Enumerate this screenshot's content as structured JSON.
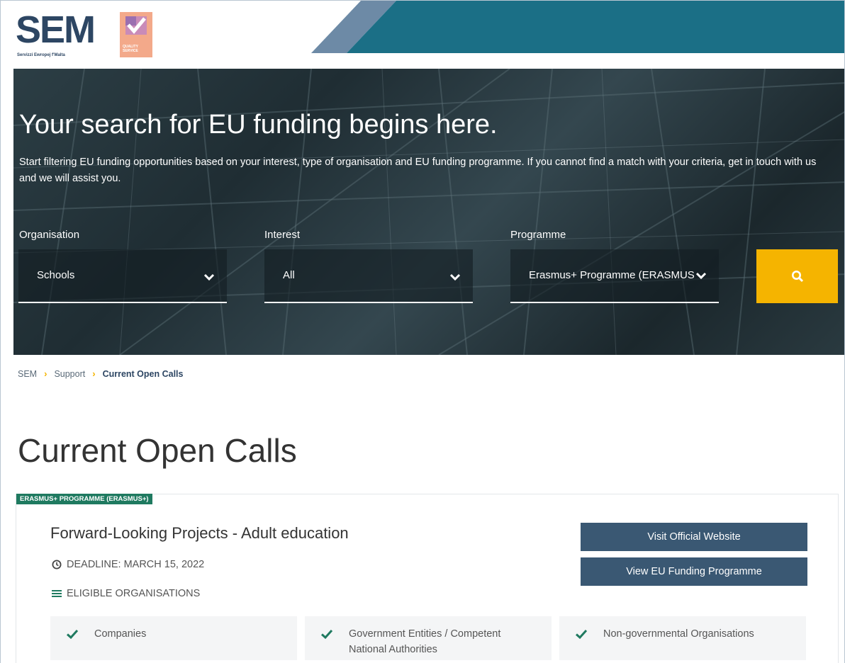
{
  "header": {
    "logo_text": "SEM",
    "logo_tagline": "Servizzi Ewropej f'Malta",
    "quality_badge_text": "QUALITY SERVICE",
    "colors": {
      "logo_navy": "#2d4663",
      "banner_teal": "#1b6f86",
      "banner_light": "#6d8aa6",
      "quality_orange": "#f3a98a"
    }
  },
  "hero": {
    "title": "Your search for EU funding begins here.",
    "text": "Start filtering EU funding opportunities based on your interest, type of organisation and EU funding programme. If you cannot find a match with your criteria, get in touch with us and we will assist you.",
    "filters": {
      "organisation": {
        "label": "Organisation",
        "value": "Schools",
        "icon": "chevron-down-icon"
      },
      "interest": {
        "label": "Interest",
        "value": "All",
        "icon": "chevron-down-icon"
      },
      "programme": {
        "label": "Programme",
        "value": "Erasmus+ Programme (ERASMUS",
        "icon": "chevron-down-icon"
      }
    },
    "search_icon": "search-icon",
    "search_color": "#f5b400"
  },
  "breadcrumb": {
    "items": [
      "SEM",
      "Support"
    ],
    "current": "Current Open Calls",
    "separator": "›"
  },
  "page": {
    "title": "Current Open Calls"
  },
  "card": {
    "programme_badge": "ERASMUS+ PROGRAMME (ERASMUS+)",
    "badge_color": "#1f7a60",
    "title": "Forward-Looking Projects - Adult education",
    "deadline": "DEADLINE: MARCH 15, 2022",
    "eligible_label": "ELIGIBLE ORGANISATIONS",
    "buttons": {
      "visit": "Visit Official Website",
      "programme": "View EU Funding Programme"
    },
    "button_color": "#3a5873",
    "organisations": [
      "Companies",
      "Government Entities / Competent National Authorities",
      "Non-governmental Organisations"
    ],
    "tick_color": "#1f7a60"
  }
}
